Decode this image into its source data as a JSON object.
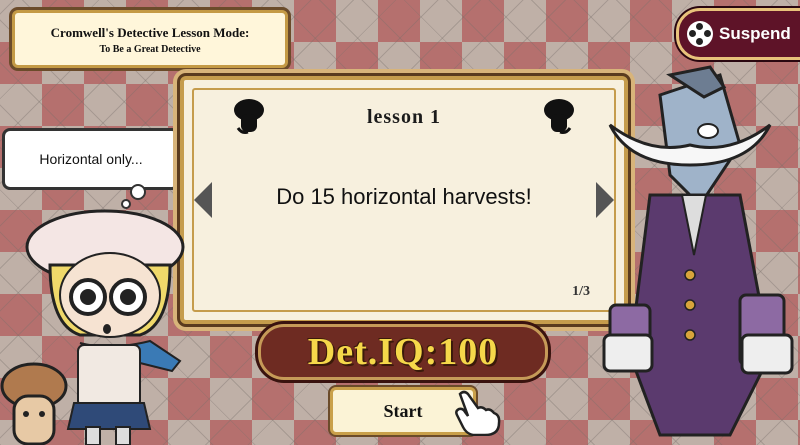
{
  "header": {
    "title_line1": "Cromwell's Detective Lesson Mode:",
    "title_line2": "To Be a Great Detective"
  },
  "suspend": {
    "label": "Suspend"
  },
  "lesson": {
    "title": "lesson  1",
    "text": "Do 15 horizontal harvests!",
    "page": "1/3"
  },
  "thought": {
    "text": "Horizontal only..."
  },
  "iq": {
    "label": "Det.IQ:100"
  },
  "start": {
    "label": "Start"
  },
  "colors": {
    "accent": "#c59c4c",
    "iq_text": "#f5d84a",
    "suspend_bg": "#5e1328"
  }
}
